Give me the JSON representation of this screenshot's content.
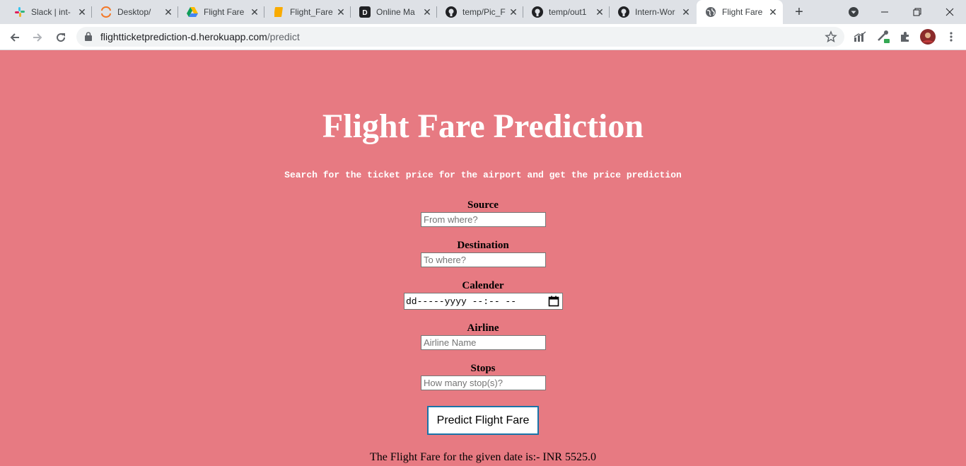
{
  "browser": {
    "tabs": [
      {
        "title": "Slack | int-",
        "icon": "slack-icon"
      },
      {
        "title": "Desktop/",
        "icon": "jupyter-icon"
      },
      {
        "title": "Flight Fare",
        "icon": "google-drive-icon"
      },
      {
        "title": "Flight_Fare",
        "icon": "notebook-icon"
      },
      {
        "title": "Online Ma",
        "icon": "d-logo-icon"
      },
      {
        "title": "temp/Pic_F",
        "icon": "github-icon"
      },
      {
        "title": "temp/out1",
        "icon": "github-icon"
      },
      {
        "title": "Intern-Wor",
        "icon": "github-icon"
      },
      {
        "title": "Flight Fare",
        "icon": "globe-icon",
        "active": true
      }
    ],
    "url_host": "flightticketprediction-d.herokuapp.com",
    "url_path": "/predict"
  },
  "page": {
    "title": "Flight Fare Prediction",
    "subtitle": "Search for the ticket price for the airport and get the price prediction",
    "fields": {
      "source": {
        "label": "Source",
        "placeholder": "From where?"
      },
      "destination": {
        "label": "Destination",
        "placeholder": "To where?"
      },
      "calendar": {
        "label": "Calender",
        "value": "dd-----yyyy --:-- --"
      },
      "airline": {
        "label": "Airline",
        "placeholder": "Airline Name"
      },
      "stops": {
        "label": "Stops",
        "placeholder": "How many stop(s)?"
      }
    },
    "submit_label": "Predict Flight Fare",
    "result": "The Flight Fare for the given date is:- INR 5525.0"
  },
  "colors": {
    "page_background": "#e77a82",
    "button_border": "#1a73a8",
    "title_text": "#ffffff"
  }
}
